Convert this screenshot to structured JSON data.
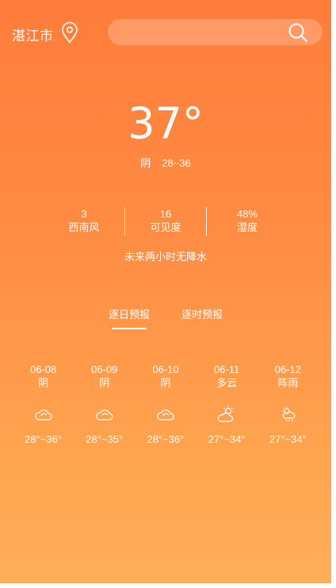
{
  "header": {
    "city": "湛江市",
    "search_placeholder": "",
    "location_icon": "location-pin-icon",
    "search_icon": "search-icon"
  },
  "current": {
    "temp": "37°",
    "condition": "阴",
    "range": "28~36"
  },
  "stats": [
    {
      "value": "3",
      "label": "西南风"
    },
    {
      "value": "16",
      "label": "可见度"
    },
    {
      "value": "48%",
      "label": "湿度"
    }
  ],
  "rain_notice": "未来两小时无降水",
  "tabs": [
    {
      "label": "逐日预报",
      "active": true
    },
    {
      "label": "逐时预报",
      "active": false
    }
  ],
  "forecast": [
    {
      "date": "06-08",
      "cond": "阴",
      "icon": "cloudy-icon",
      "range": "28°~36°"
    },
    {
      "date": "06-09",
      "cond": "阴",
      "icon": "cloudy-icon",
      "range": "28°~35°"
    },
    {
      "date": "06-10",
      "cond": "阴",
      "icon": "cloudy-icon",
      "range": "28°~36°"
    },
    {
      "date": "06-11",
      "cond": "多云",
      "icon": "partly-cloudy-icon",
      "range": "27°~34°"
    },
    {
      "date": "06-12",
      "cond": "阵雨",
      "icon": "shower-icon",
      "range": "27°~34°"
    }
  ],
  "colors": {
    "gradient_top": "#ff7c3a",
    "gradient_bottom": "#ffae58",
    "text": "#ffffff"
  }
}
